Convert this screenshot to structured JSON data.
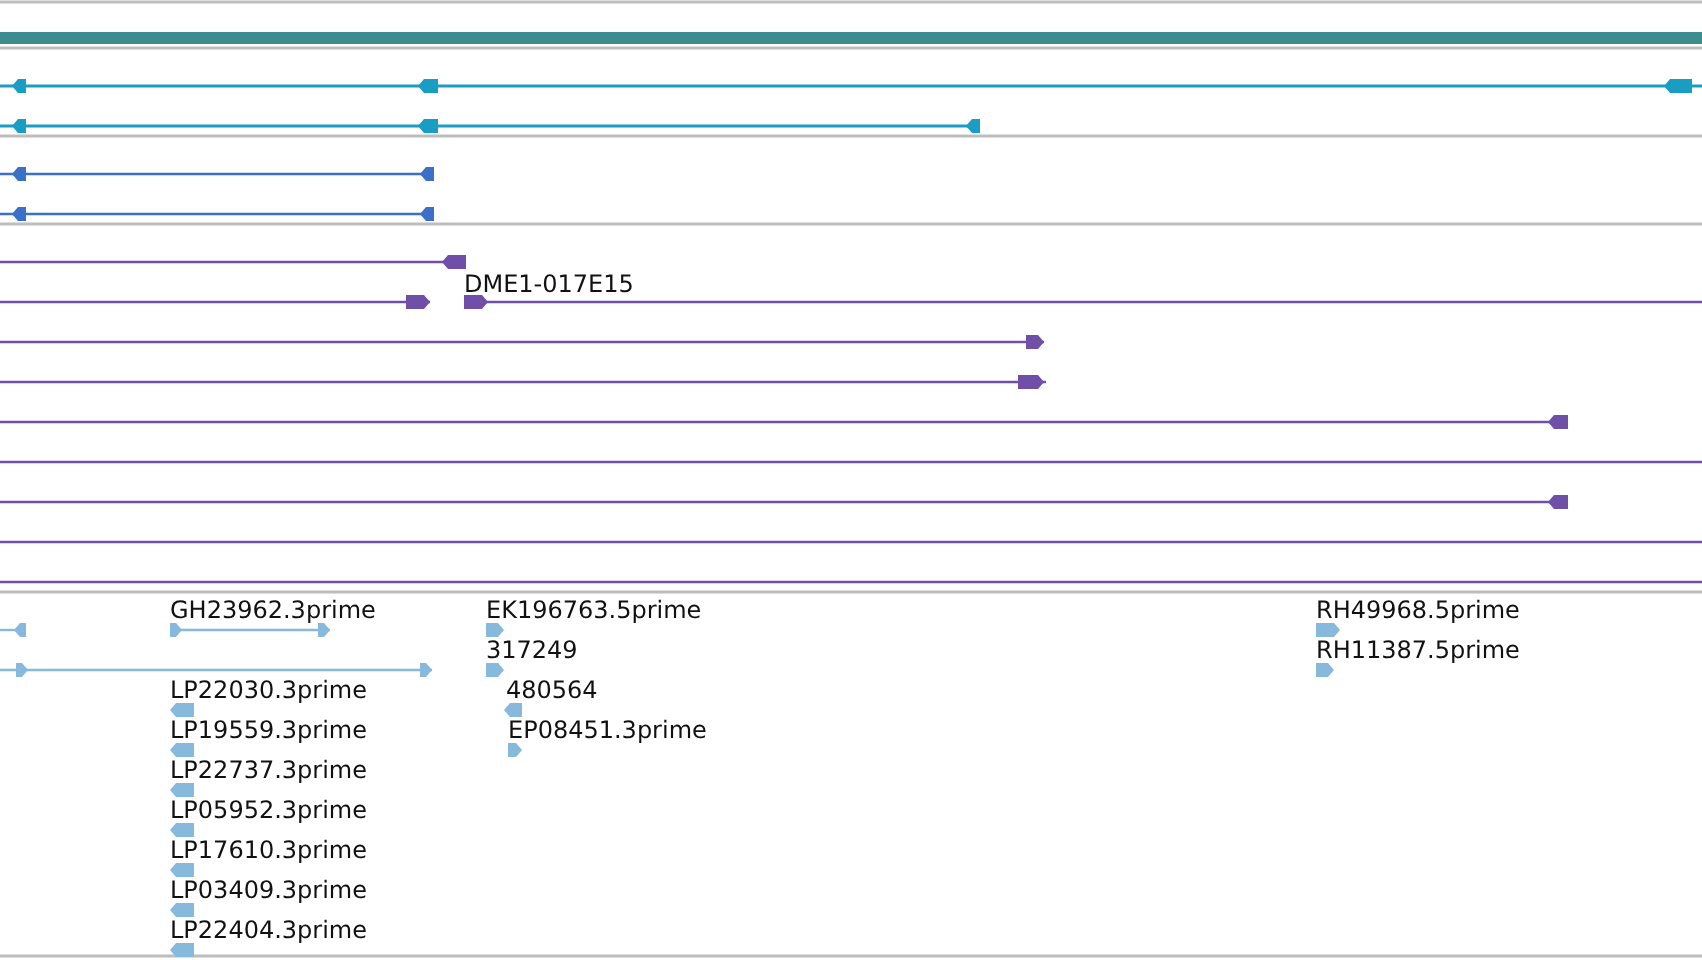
{
  "tracks": [
    {
      "kind": "gene",
      "color": "#1a9dc2",
      "features": [
        {
          "kind": "arrow",
          "reverse": true
        },
        {
          "kind": "arrow",
          "reverse": true
        }
      ]
    },
    {
      "kind": "transcript",
      "color": "#3a70c8",
      "features": [
        {
          "kind": "arrow",
          "reverse": true
        },
        {
          "kind": "arrow",
          "reverse": true
        }
      ]
    },
    {
      "kind": "clone",
      "color": "#6f4fa8",
      "features": [
        {
          "kind": "arrow",
          "reverse": true
        },
        {
          "kind": "arrow",
          "reverse": false,
          "label": "DME1-017E15"
        },
        {
          "kind": "arrow",
          "reverse": false
        },
        {
          "kind": "arrow",
          "reverse": false
        },
        {
          "kind": "arrow",
          "reverse": true
        },
        {
          "kind": "bar"
        },
        {
          "kind": "arrow",
          "reverse": true
        },
        {
          "kind": "bar"
        },
        {
          "kind": "bar"
        }
      ]
    },
    {
      "kind": "est",
      "color": "#86b9dc",
      "features": [
        {
          "kind": "arrow",
          "reverse": true
        },
        {
          "kind": "arrow",
          "reverse": false,
          "label": "GH23962.3prime"
        },
        {
          "kind": "arrow",
          "reverse": false
        },
        {
          "kind": "arrow",
          "reverse": false,
          "label": "EK196763.5prime"
        },
        {
          "kind": "arrow",
          "reverse": false,
          "label": "317249"
        },
        {
          "kind": "arrow",
          "reverse": true,
          "label": "480564"
        },
        {
          "kind": "arrow",
          "reverse": false,
          "label": "EP08451.3prime"
        },
        {
          "kind": "arrow",
          "reverse": true,
          "label": "LP22030.3prime"
        },
        {
          "kind": "arrow",
          "reverse": true,
          "label": "LP19559.3prime"
        },
        {
          "kind": "arrow",
          "reverse": true,
          "label": "LP22737.3prime"
        },
        {
          "kind": "arrow",
          "reverse": true,
          "label": "LP05952.3prime"
        },
        {
          "kind": "arrow",
          "reverse": true,
          "label": "LP17610.3prime"
        },
        {
          "kind": "arrow",
          "reverse": true,
          "label": "LP03409.3prime"
        },
        {
          "kind": "arrow",
          "reverse": true,
          "label": "LP22404.3prime"
        },
        {
          "kind": "arrow",
          "reverse": false,
          "label": "RH49968.5prime"
        },
        {
          "kind": "arrow",
          "reverse": false,
          "label": "RH11387.5prime"
        }
      ]
    }
  ]
}
